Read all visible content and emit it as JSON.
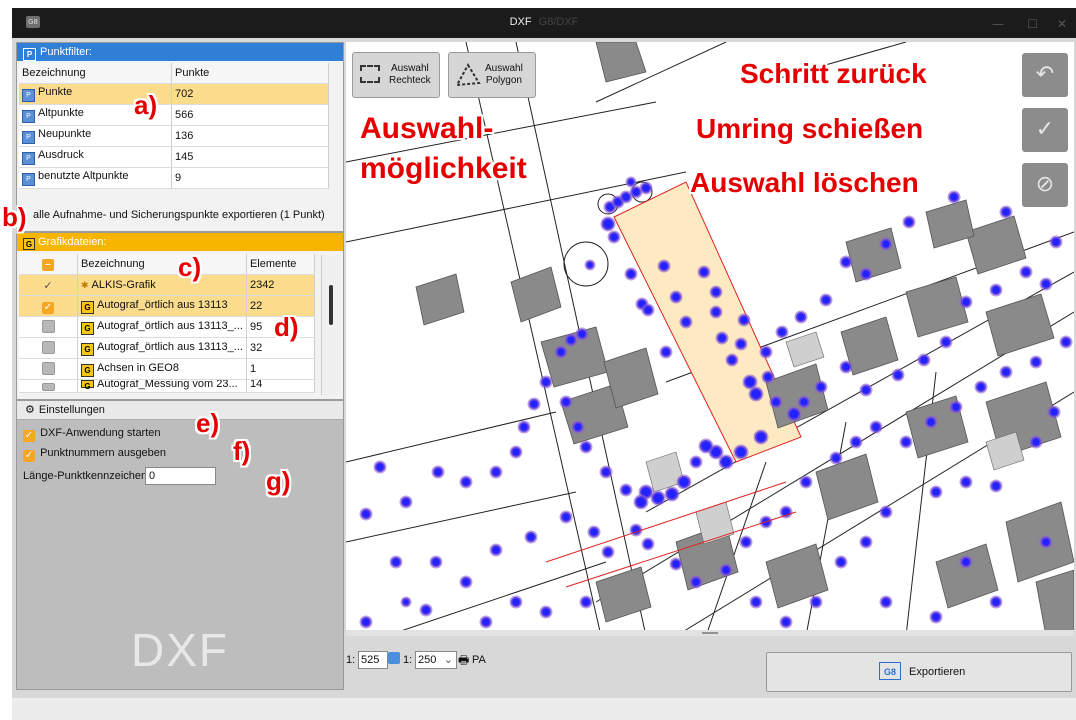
{
  "window": {
    "title": "DXF",
    "title_suffix": "G8/DXF"
  },
  "punktfilter": {
    "header": "Punktfilter:",
    "col_name": "Bezeichnung",
    "col_points": "Punkte",
    "rows": [
      {
        "name": "Punkte",
        "count": "702"
      },
      {
        "name": "Altpunkte",
        "count": "566"
      },
      {
        "name": "Neupunkte",
        "count": "136"
      },
      {
        "name": "Ausdruck",
        "count": "145"
      },
      {
        "name": "benutzte Altpunkte",
        "count": "9"
      }
    ],
    "export_all_label": "alle Aufnahme- und Sicherungspunkte exportieren (1 Punkt)"
  },
  "grafikdateien": {
    "header": "Grafikdateien:",
    "col_name": "Bezeichnung",
    "col_elements": "Elemente",
    "rows": [
      {
        "name": "ALKIS-Grafik",
        "count": "2342",
        "checked": true
      },
      {
        "name": "Autograf_örtlich aus 13113",
        "count": "22",
        "checked": true
      },
      {
        "name": "Autograf_örtlich aus 13113_...",
        "count": "95",
        "checked": false
      },
      {
        "name": "Autograf_örtlich aus 13113_...",
        "count": "32",
        "checked": false
      },
      {
        "name": "Achsen in GEO8",
        "count": "1",
        "checked": false
      },
      {
        "name": "Autograf_Messung vom 23...",
        "count": "14",
        "checked": false
      }
    ]
  },
  "einstellungen": {
    "header": "Einstellungen",
    "opt_dxf": "DXF-Anwendung starten",
    "opt_nums": "Punktnummern ausgeben",
    "length_label": "Länge-Punktkennzeichen:",
    "length_value": "0",
    "logo": "DXF"
  },
  "map": {
    "btn_rect": [
      "Auswahl",
      "Rechteck"
    ],
    "btn_poly": [
      "Auswahl",
      "Polygon"
    ],
    "right_buttons": [
      "undo-icon",
      "check-icon",
      "clear-icon"
    ]
  },
  "bottom": {
    "scale_prefix": "1:",
    "scale_value": "525",
    "scale2_prefix": "1:",
    "scale2_value": "250",
    "pa_label": "PA",
    "export_label": "Exportieren",
    "export_icon_text": "G8"
  },
  "annotations": {
    "a": "a)",
    "b": "b)",
    "c": "c)",
    "d": "d)",
    "e": "e)",
    "f": "f)",
    "g": "g)",
    "auswahl1": "Auswahl-",
    "auswahl2": "möglichkeit",
    "schritt": "Schritt zurück",
    "umring": "Umring schießen",
    "loeschen": "Auswahl löschen"
  },
  "colors": {
    "punktfilter_header": "#2f7fd6",
    "grafik_header": "#f7b500",
    "selection": "#fbdc8c",
    "annotation": "#e40000"
  }
}
